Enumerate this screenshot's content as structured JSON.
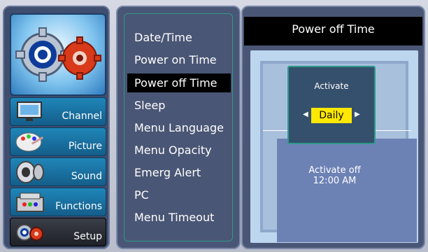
{
  "sidebar": {
    "items": [
      {
        "label": "Channel",
        "icon": "tv-icon"
      },
      {
        "label": "Picture",
        "icon": "palette-icon"
      },
      {
        "label": "Sound",
        "icon": "speaker-icon"
      },
      {
        "label": "Functions",
        "icon": "toolbox-icon"
      },
      {
        "label": "Setup",
        "icon": "gears-icon",
        "selected": true
      }
    ]
  },
  "menu": {
    "items": [
      {
        "label": "Date/Time"
      },
      {
        "label": "Power on Time"
      },
      {
        "label": "Power off Time",
        "selected": true
      },
      {
        "label": "Sleep"
      },
      {
        "label": "Menu Language"
      },
      {
        "label": "Menu Opacity"
      },
      {
        "label": "Emerg Alert"
      },
      {
        "label": "PC"
      },
      {
        "label": "Menu Timeout"
      }
    ]
  },
  "detail": {
    "title": "Power off Time",
    "field_label": "Activate",
    "field_value": "Daily",
    "status_line1": "Activate  off",
    "status_line2": "12:00 AM"
  },
  "colors": {
    "highlight": "#ffe800",
    "accent_border": "#2e9a8c",
    "category_blue": "#1f86b8"
  }
}
